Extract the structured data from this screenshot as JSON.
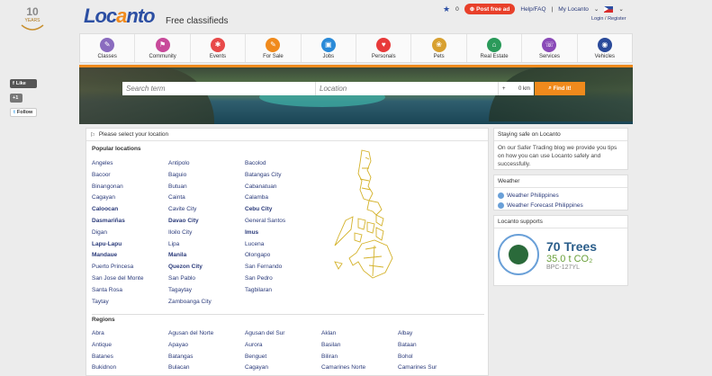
{
  "anniversary": {
    "years": "10",
    "label": "YEARS"
  },
  "social": {
    "like": "Like",
    "gplus": "+1",
    "follow": "Follow"
  },
  "header": {
    "logo_pre": "Loc",
    "logo_o": "a",
    "logo_post": "nto",
    "tagline": "Free classifieds",
    "favorites_count": "0",
    "post_ad": "Post free ad",
    "help": "Help/FAQ",
    "account": "My Locanto",
    "login": "Login",
    "register": "Register"
  },
  "nav": [
    {
      "label": "Classes",
      "color": "#8a6bbf",
      "icon": "classes-icon",
      "glyph": "✎"
    },
    {
      "label": "Community",
      "color": "#c84a9a",
      "icon": "community-icon",
      "glyph": "⚑"
    },
    {
      "label": "Events",
      "color": "#e84a4a",
      "icon": "events-icon",
      "glyph": "✱"
    },
    {
      "label": "For Sale",
      "color": "#f08a1c",
      "icon": "for-sale-icon",
      "glyph": "✎"
    },
    {
      "label": "Jobs",
      "color": "#2a8ad8",
      "icon": "jobs-icon",
      "glyph": "▣"
    },
    {
      "label": "Personals",
      "color": "#e83a3a",
      "icon": "personals-icon",
      "glyph": "♥"
    },
    {
      "label": "Pets",
      "color": "#d8a030",
      "icon": "pets-icon",
      "glyph": "❀"
    },
    {
      "label": "Real Estate",
      "color": "#2a9a5a",
      "icon": "real-estate-icon",
      "glyph": "⌂"
    },
    {
      "label": "Services",
      "color": "#8a4ab8",
      "icon": "services-icon",
      "glyph": "☏"
    },
    {
      "label": "Vehicles",
      "color": "#2a4a9a",
      "icon": "vehicles-icon",
      "glyph": "◉"
    }
  ],
  "search": {
    "term_placeholder": "Search term",
    "location_placeholder": "Location",
    "radius": "0 km",
    "find_label": "Find it!"
  },
  "main": {
    "prompt": "Please select your location",
    "popular_title": "Popular locations",
    "popular_cols": [
      [
        "Angeles",
        "Bacoor",
        "Binangonan",
        "Cagayan",
        "Caloocan",
        "Dasmariñas",
        "Digan",
        "Lapu-Lapu",
        "Mandaue",
        "Puerto Princesa",
        "San Jose del Monte",
        "Santa Rosa",
        "Taytay"
      ],
      [
        "Antipolo",
        "Baguio",
        "Butuan",
        "Cainta",
        "Cavite City",
        "Davao City",
        "Iloilo City",
        "Lipa",
        "Manila",
        "Quezon City",
        "San Pablo",
        "Tagaytay",
        "Zamboanga City"
      ],
      [
        "Bacolod",
        "Batangas City",
        "Cabanatuan",
        "Calamba",
        "Cebu City",
        "General Santos",
        "Imus",
        "Lucena",
        "Olongapo",
        "San Fernando",
        "San Pedro",
        "Tagbilaran"
      ]
    ],
    "popular_bold": [
      "Caloocan",
      "Dasmariñas",
      "Lapu-Lapu",
      "Mandaue",
      "Davao City",
      "Manila",
      "Quezon City",
      "Cebu City",
      "Imus"
    ],
    "regions_title": "Regions",
    "region_cols": [
      [
        "Abra",
        "Antique",
        "Batanes",
        "Bukidnon"
      ],
      [
        "Agusan del Norte",
        "Apayao",
        "Batangas",
        "Bulacan"
      ],
      [
        "Agusan del Sur",
        "Aurora",
        "Benguet",
        "Cagayan"
      ],
      [
        "Aklan",
        "Basilan",
        "Biliran",
        "Camarines Norte"
      ],
      [
        "Albay",
        "Bataan",
        "Bohol",
        "Camarines Sur"
      ]
    ]
  },
  "safety": {
    "title": "Staying safe on Locanto",
    "text": "On our Safer Trading blog we provide you tips on how you can use Locanto safely and successfully."
  },
  "weather": {
    "title": "Weather",
    "links": [
      "Weather Philippines",
      "Weather Forecast Philippines"
    ]
  },
  "supports": {
    "title": "Locanto supports",
    "trees": "70 Trees",
    "co2": "35.0 t CO₂",
    "code": "BPC-127YL"
  }
}
